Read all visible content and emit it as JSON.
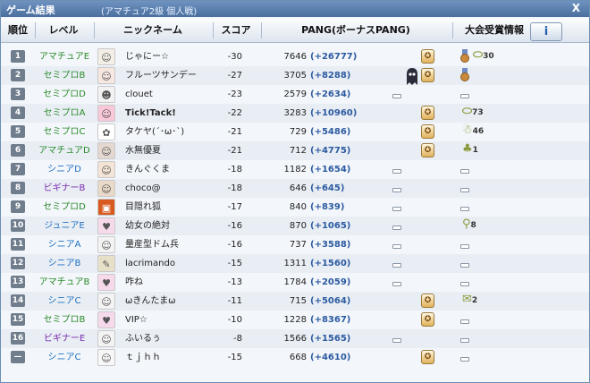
{
  "window": {
    "title": "ゲーム結果",
    "subtitle": "(アマチュア2級 個人戦)",
    "close_label": "X"
  },
  "header": {
    "rank": "順位",
    "level": "レベル",
    "nickname": "ニックネーム",
    "score": "スコア",
    "pang": "PANG(ボーナスPANG)",
    "info": "大会受賞情報",
    "info_button": "i"
  },
  "colors": {
    "level_amateur": "#2a8a2a",
    "level_semipro": "#2a8a2a",
    "level_senior": "#1f6fbf",
    "level_beginner": "#7a2ab0",
    "level_junior": "#1f6fbf",
    "bonus": "#2c5aa0"
  },
  "rows": [
    {
      "rank": "1",
      "level": "アマチュアE",
      "level_color": "#2a8a2a",
      "avatar": "nine-tail",
      "nick": "じゃにー☆",
      "score": "-30",
      "pang": "7646",
      "bonus": "(+26777)",
      "cup": true,
      "medal": true,
      "item": "30",
      "item_icon": "capsule"
    },
    {
      "rank": "2",
      "level": "セミプロB",
      "level_color": "#2a8a2a",
      "avatar": "girl",
      "nick": "フルーツサンデー",
      "score": "-27",
      "pang": "3705",
      "bonus": "(+8288)",
      "cup": true,
      "medal": true,
      "item": "",
      "item_icon": ""
    },
    {
      "rank": "3",
      "level": "セミプロD",
      "level_color": "#2a8a2a",
      "avatar": "chibi",
      "nick": "clouet",
      "score": "-23",
      "pang": "2579",
      "bonus": "(+2634)",
      "cup": false,
      "medal": false,
      "item": "",
      "item_icon": "dash"
    },
    {
      "rank": "4",
      "level": "セミプロA",
      "level_color": "#2a8a2a",
      "avatar": "pink-girl",
      "nick": "Tick!Tack!",
      "score": "-22",
      "pang": "3283",
      "bonus": "(+10960)",
      "cup": true,
      "medal": false,
      "item": "73",
      "item_icon": "capsule"
    },
    {
      "rank": "5",
      "level": "セミプロC",
      "level_color": "#2a8a2a",
      "avatar": "bunny",
      "nick": "タケヤ(´･ω･`)",
      "score": "-21",
      "pang": "729",
      "bonus": "(+5486)",
      "cup": true,
      "medal": false,
      "item": "46",
      "item_icon": "ghost"
    },
    {
      "rank": "6",
      "level": "アマチュアD",
      "level_color": "#2a8a2a",
      "avatar": "dark-hair",
      "nick": "水無優夏",
      "score": "-21",
      "pang": "712",
      "bonus": "(+4775)",
      "cup": true,
      "medal": false,
      "item": "1",
      "item_icon": "clover"
    },
    {
      "rank": "7",
      "level": "シニアD",
      "level_color": "#1f6fbf",
      "avatar": "girl2",
      "nick": "きんぐくま",
      "score": "-18",
      "pang": "1182",
      "bonus": "(+1654)",
      "cup": false,
      "medal": false,
      "item": "",
      "item_icon": "dash"
    },
    {
      "rank": "8",
      "level": "ビギナーB",
      "level_color": "#7a2ab0",
      "avatar": "boy",
      "nick": "choco@",
      "score": "-18",
      "pang": "646",
      "bonus": "(+645)",
      "cup": false,
      "medal": false,
      "item": "",
      "item_icon": "dash"
    },
    {
      "rank": "9",
      "level": "セミプロD",
      "level_color": "#2a8a2a",
      "avatar": "fox",
      "nick": "目隠れ狐",
      "score": "-17",
      "pang": "840",
      "bonus": "(+839)",
      "cup": false,
      "medal": false,
      "item": "",
      "item_icon": "dash"
    },
    {
      "rank": "10",
      "level": "ジュニアE",
      "level_color": "#1f6fbf",
      "avatar": "pink-box",
      "nick": "幼女の絶対",
      "score": "-16",
      "pang": "870",
      "bonus": "(+1065)",
      "cup": false,
      "medal": false,
      "item": "8",
      "item_icon": "club"
    },
    {
      "rank": "11",
      "level": "シニアA",
      "level_color": "#1f6fbf",
      "avatar": "pig",
      "nick": "量産型ドム兵",
      "score": "-16",
      "pang": "737",
      "bonus": "(+3588)",
      "cup": false,
      "medal": false,
      "item": "",
      "item_icon": "dash"
    },
    {
      "rank": "12",
      "level": "シニアB",
      "level_color": "#1f6fbf",
      "avatar": "sign",
      "nick": "lacrimando",
      "score": "-15",
      "pang": "1311",
      "bonus": "(+1560)",
      "cup": false,
      "medal": false,
      "item": "",
      "item_icon": "dash"
    },
    {
      "rank": "13",
      "level": "アマチュアB",
      "level_color": "#2a8a2a",
      "avatar": "pink-box",
      "nick": "咋ね",
      "score": "-13",
      "pang": "1784",
      "bonus": "(+2059)",
      "cup": false,
      "medal": false,
      "item": "",
      "item_icon": "dash"
    },
    {
      "rank": "14",
      "level": "シニアC",
      "level_color": "#1f6fbf",
      "avatar": "pig",
      "nick": "ωきんたまω",
      "score": "-11",
      "pang": "715",
      "bonus": "(+5064)",
      "cup": true,
      "medal": false,
      "item": "2",
      "item_icon": "scroll"
    },
    {
      "rank": "15",
      "level": "セミプロB",
      "level_color": "#2a8a2a",
      "avatar": "pink-box",
      "nick": "VIP☆",
      "score": "-10",
      "pang": "1228",
      "bonus": "(+8367)",
      "cup": true,
      "medal": false,
      "item": "",
      "item_icon": "dash"
    },
    {
      "rank": "16",
      "level": "ビギナーE",
      "level_color": "#7a2ab0",
      "avatar": "pig",
      "nick": "ふいるぅ",
      "score": "-8",
      "pang": "1566",
      "bonus": "(+1565)",
      "cup": false,
      "medal": false,
      "item": "",
      "item_icon": "dash"
    },
    {
      "rank": "—",
      "level": "シニアC",
      "level_color": "#1f6fbf",
      "avatar": "cat",
      "nick": "ｔｊｈｈ",
      "score": "-15",
      "pang": "668",
      "bonus": "(+4610)",
      "cup": true,
      "medal": false,
      "item": "",
      "item_icon": "dash"
    }
  ]
}
